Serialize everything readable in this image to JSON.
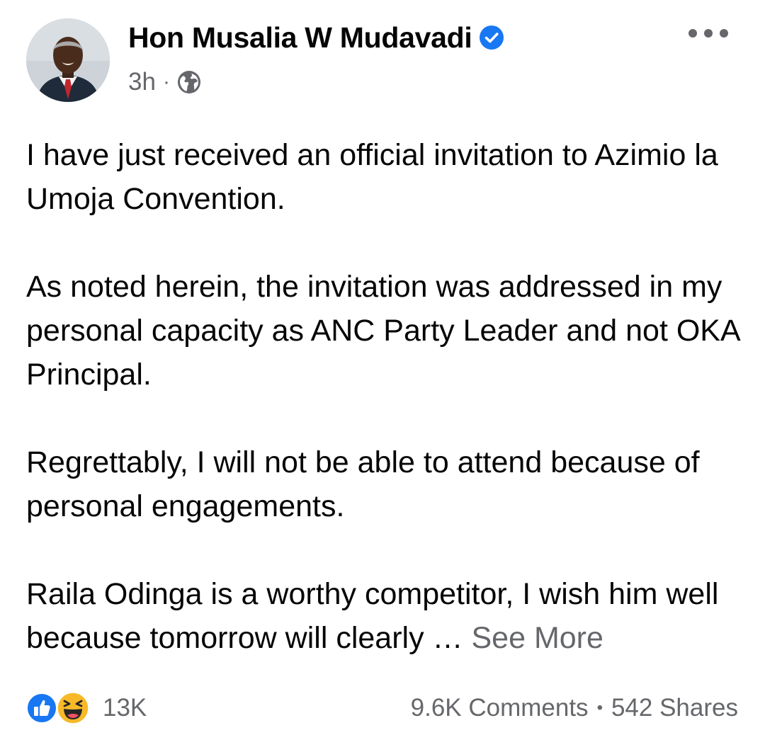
{
  "author": {
    "name": "Hon Musalia W Mudavadi",
    "verified": true,
    "avatar_icon": "profile-photo"
  },
  "meta": {
    "time": "3h",
    "separator": "·",
    "audience_icon": "globe-icon"
  },
  "post": {
    "paragraphs": [
      "I have just received an official invitation to Azimio la Umoja Convention.",
      "As noted herein, the invitation was addressed in my personal capacity as ANC Party Leader and not OKA Principal.",
      "Regrettably, I will not be able to attend because of personal engagements.",
      "Raila Odinga is a worthy competitor, I wish him well because tomorrow will clearly …"
    ],
    "see_more": "See More"
  },
  "footer": {
    "reaction_icons": [
      "like-icon",
      "haha-icon"
    ],
    "reaction_count": "13K",
    "comments": "9.6K Comments",
    "separator": "•",
    "shares": "542 Shares"
  },
  "colors": {
    "text": "#050505",
    "secondary": "#65676b",
    "verified_blue": "#1877f2",
    "haha_yellow": "#f7b928"
  }
}
